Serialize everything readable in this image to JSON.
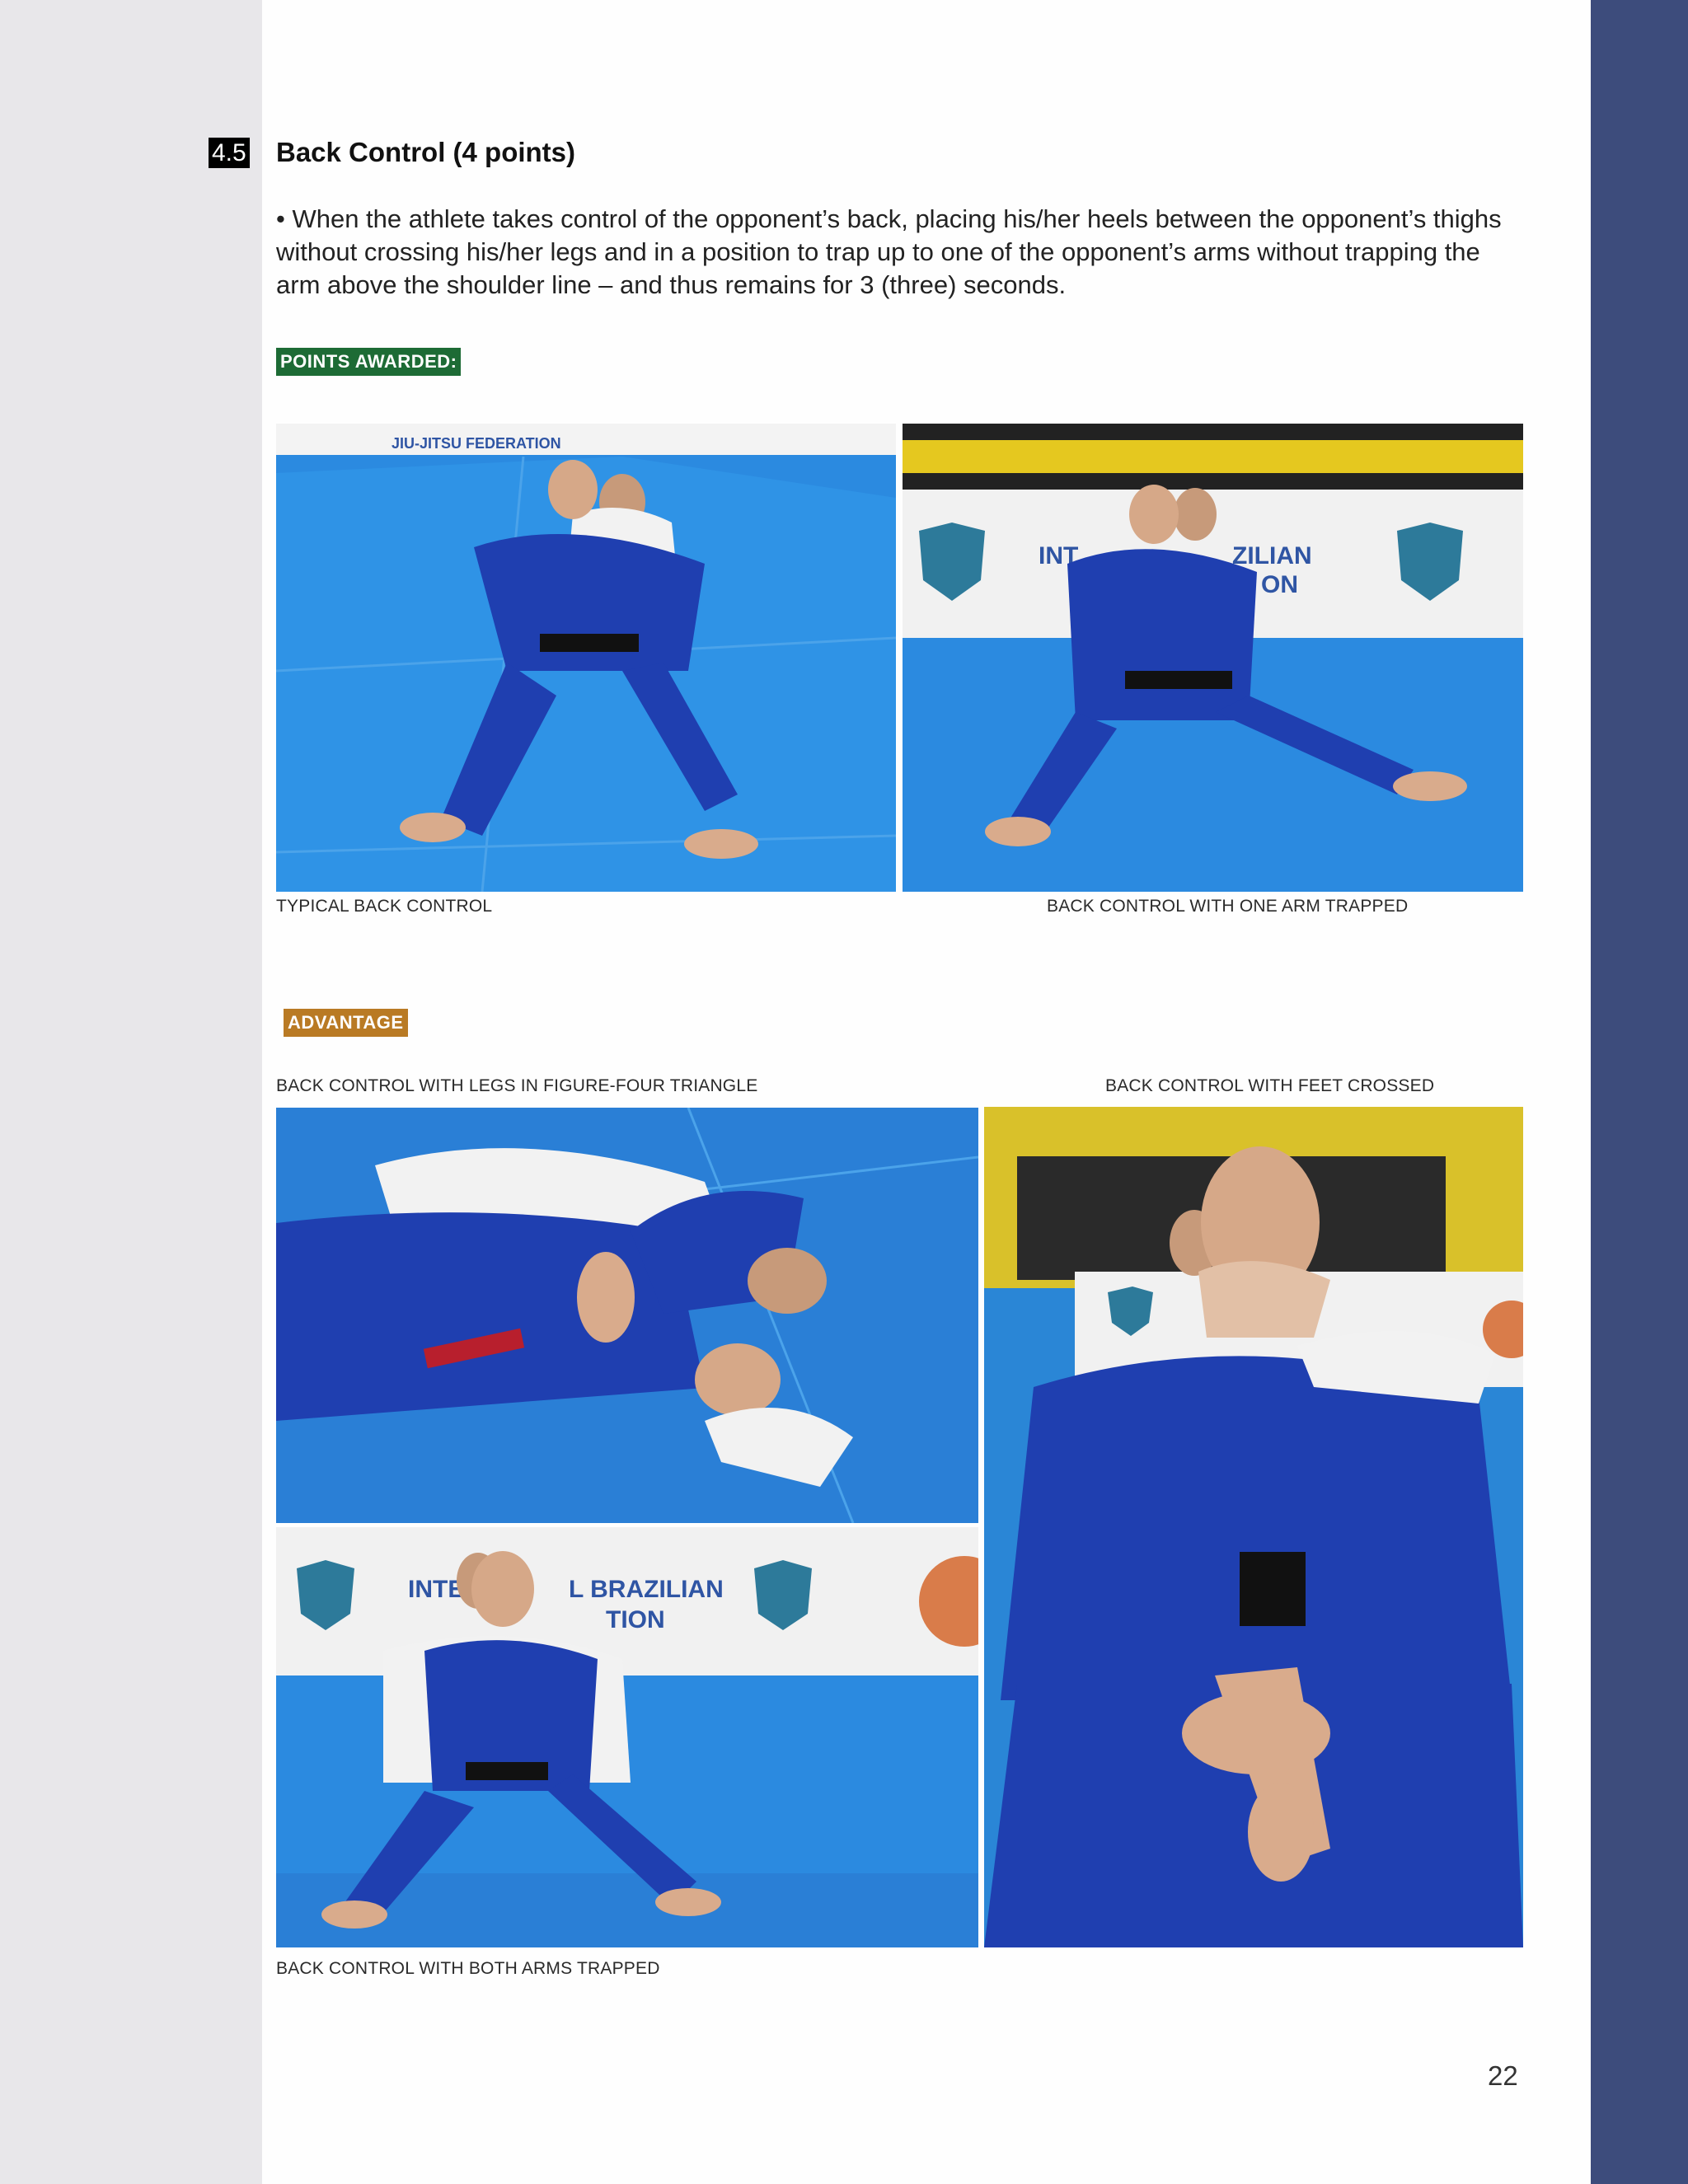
{
  "section": {
    "number": "4.5",
    "title": "Back Control (4 points)",
    "body": "• When the athlete takes control of the opponent’s back, placing his/her heels between the opponent’s thighs without crossing his/her legs and in a position to trap up to one of the opponent’s arms without trapping the arm above the shoulder line – and thus remains for 3 (three) seconds."
  },
  "badges": {
    "points_awarded": "POINTS AWARDED:",
    "advantage": "ADVANTAGE"
  },
  "banner_text": {
    "federation_1": "JIU-JITSU FEDERATION",
    "inte": "INT",
    "zilian": "ZILIAN",
    "on": "ON",
    "inter": "INTER",
    "brazilian": "L BRAZILIAN",
    "tion": "TION"
  },
  "captions": {
    "typical": "TYPICAL BACK CONTROL",
    "one_arm": "BACK CONTROL WITH ONE ARM TRAPPED",
    "figure_four": "BACK CONTROL WITH LEGS IN FIGURE-FOUR TRIANGLE",
    "feet_crossed": "BACK CONTROL WITH FEET CROSSED",
    "both_arms": "BACK CONTROL WITH BOTH ARMS TRAPPED"
  },
  "page_number": "22",
  "colors": {
    "accent_page_edge": "#3d4c7c",
    "points_badge": "#1d6b35",
    "advantage_badge": "#b97a24",
    "mat_blue": "#2a86d6",
    "gi_blue": "#1f3fb0"
  }
}
